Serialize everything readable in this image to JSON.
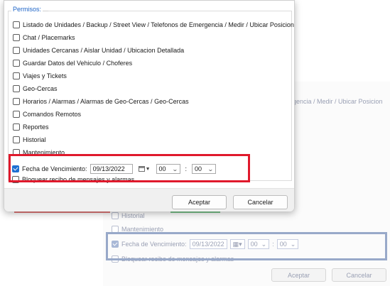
{
  "front": {
    "group_label": "Permisos:",
    "permissions": [
      {
        "label": "Listado de Unidades / Backup / Street View / Telefonos de Emergencia / Medir / Ubicar Posicion",
        "checked": false
      },
      {
        "label": "Chat / Placemarks",
        "checked": false
      },
      {
        "label": "Unidades Cercanas / Aislar Unidad / Ubicacion Detallada",
        "checked": false
      },
      {
        "label": "Guardar Datos del Vehiculo / Choferes",
        "checked": false
      },
      {
        "label": "Viajes y Tickets",
        "checked": false
      },
      {
        "label": "Geo-Cercas",
        "checked": false
      },
      {
        "label": "Horarios / Alarmas / Alarmas de Geo-Cercas / Geo-Cercas",
        "checked": false
      },
      {
        "label": "Comandos Remotos",
        "checked": false
      },
      {
        "label": "Reportes",
        "checked": false
      },
      {
        "label": "Historial",
        "checked": false
      },
      {
        "label": "Mantenimiento",
        "checked": false
      }
    ],
    "expiry": {
      "label": "Fecha de Vencimiento:",
      "checked": true,
      "date": "09/13/2022",
      "hour": "00",
      "minute": "00",
      "separator": ":"
    },
    "hidden_row_label": "Bloquear recibo de mensajes y alarmas",
    "accept_label": "Aceptar",
    "cancel_label": "Cancelar"
  },
  "background": {
    "tail_text": "rgencia / Medir / Ubicar Posicion",
    "historial": "Historial",
    "mantenimiento": "Mantenimiento",
    "expiry_label": "Fecha de Vencimiento:",
    "date": "09/13/2022",
    "hour": "00",
    "minute": "00",
    "separator": ":",
    "hidden_row_label": "Bloquear recibo de mensajes y alarmas",
    "accept_label": "Aceptar",
    "cancel_label": "Cancelar"
  },
  "colors": {
    "highlight_front": "#e0192c",
    "highlight_back": "#98a9c9",
    "accent": "#1f6fd1",
    "group_label": "#1c63c7"
  },
  "icons": [
    "calendar-icon",
    "chevron-down-icon",
    "checkmark-icon"
  ]
}
